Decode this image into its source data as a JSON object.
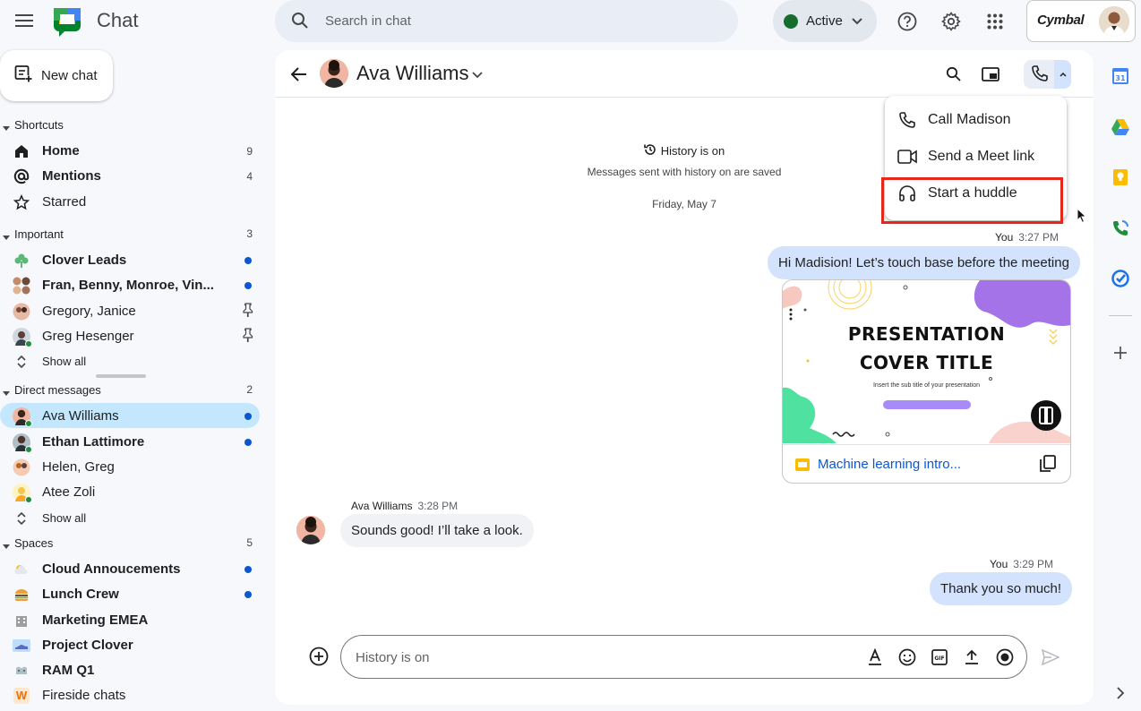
{
  "app": {
    "name": "Chat",
    "brand": "Cymbal"
  },
  "search": {
    "placeholder": "Search in chat"
  },
  "status": {
    "label": "Active",
    "color": "#146c2e"
  },
  "nav": {
    "new_chat": "New chat",
    "shortcuts": {
      "header": "Shortcuts",
      "items": [
        {
          "label": "Home",
          "count": "9",
          "icon": "home-icon"
        },
        {
          "label": "Mentions",
          "count": "4",
          "icon": "at-icon"
        },
        {
          "label": "Starred",
          "icon": "star-icon"
        }
      ]
    },
    "important": {
      "header": "Important",
      "count": "3",
      "items": [
        {
          "label": "Clover Leads"
        },
        {
          "label": "Fran, Benny, Monroe, Vin..."
        },
        {
          "label": "Gregory, Janice"
        },
        {
          "label": "Greg Hesenger"
        }
      ],
      "show_all": "Show all"
    },
    "direct_messages": {
      "header": "Direct messages",
      "count": "2",
      "items": [
        {
          "label": "Ava Williams"
        },
        {
          "label": "Ethan Lattimore"
        },
        {
          "label": "Helen, Greg"
        },
        {
          "label": "Atee Zoli"
        }
      ],
      "show_all": "Show all"
    },
    "spaces": {
      "header": "Spaces",
      "count": "5",
      "items": [
        {
          "label": "Cloud Annoucements"
        },
        {
          "label": "Lunch Crew"
        },
        {
          "label": "Marketing EMEA"
        },
        {
          "label": "Project Clover"
        },
        {
          "label": "RAM Q1"
        },
        {
          "label": "Fireside chats",
          "icon_letter": "W"
        }
      ]
    }
  },
  "conversation": {
    "name": "Ava Williams",
    "history_title": "History is on",
    "history_sub": "Messages sent with history on are saved",
    "date": "Friday, May 7",
    "messages": [
      {
        "sender": "You",
        "time": "3:27 PM",
        "text": "Hi Madision! Let’s touch base before the meeting"
      },
      {
        "sender": "Ava Williams",
        "time": "3:28 PM",
        "text": "Sounds good! I’ll take a look."
      },
      {
        "sender": "You",
        "time": "3:29 PM",
        "text": "Thank you so much!"
      }
    ],
    "attachment": {
      "slide_title_line1": "PRESENTATION",
      "slide_title_line2": "COVER TITLE",
      "slide_subtitle": "Insert the sub title of your presentation",
      "name": "Machine learning intro..."
    },
    "composer_placeholder": "History is on"
  },
  "call_menu": {
    "items": [
      {
        "label": "Call Madison",
        "icon": "phone-icon"
      },
      {
        "label": "Send a Meet link",
        "icon": "video-icon"
      },
      {
        "label": "Start a huddle",
        "icon": "headphones-icon"
      }
    ],
    "highlight_color": "#e8271b"
  },
  "colors": {
    "accent": "#0b57d0",
    "selected_nav": "#c2e7ff",
    "my_bubble": "#d3e3fd"
  }
}
